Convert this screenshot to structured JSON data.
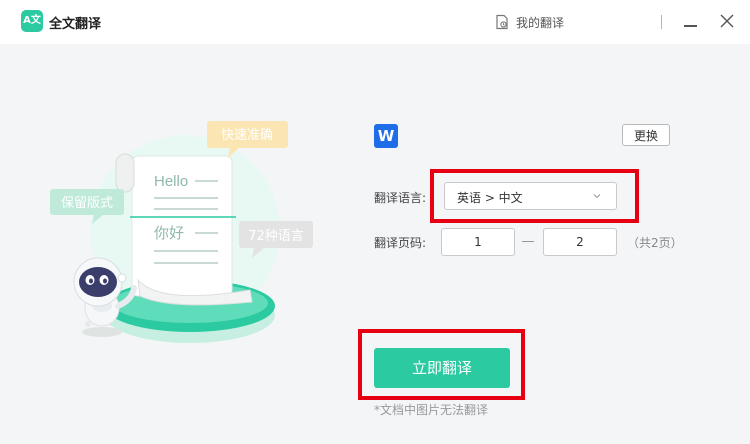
{
  "app": {
    "title": "全文翻译",
    "logo_text": "A文"
  },
  "header": {
    "my_translations_label": "我的翻译"
  },
  "illustration": {
    "bubble_fast": "快速准确",
    "bubble_format": "保留版式",
    "bubble_languages": "72种语言",
    "doc_hello": "Hello",
    "doc_nihao": "你好"
  },
  "file": {
    "icon_letter": "W",
    "change_label": "更换"
  },
  "language": {
    "label": "翻译语言:",
    "value": "英语 > 中文"
  },
  "pages": {
    "label": "翻译页码:",
    "from": "1",
    "to": "2",
    "total_text": "（共2页）"
  },
  "actions": {
    "translate_label": "立即翻译",
    "note": "*文档中图片无法翻译"
  },
  "colors": {
    "accent": "#2ccaa1",
    "highlight": "#e60012",
    "word_blue": "#1f6ee8"
  }
}
